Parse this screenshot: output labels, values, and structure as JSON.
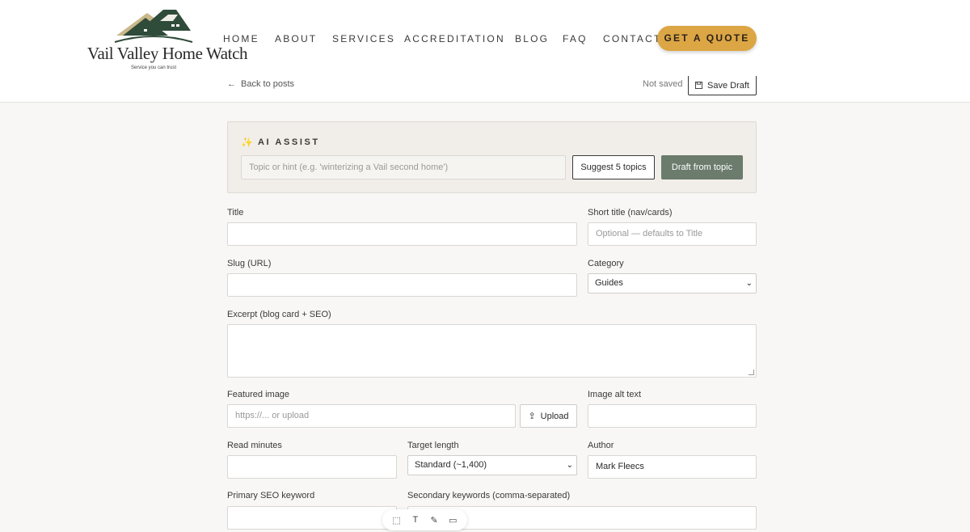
{
  "logo": {
    "name": "Vail Valley Home Watch",
    "tagline": "Service you can trust"
  },
  "nav": {
    "items": [
      "HOME",
      "ABOUT",
      "SERVICES",
      "ACCREDITATION",
      "BLOG",
      "FAQ",
      "CONTACT"
    ],
    "cta": "GET A QUOTE"
  },
  "editor_bar": {
    "back": "Back to posts",
    "status": "Not saved",
    "save": "Save Draft"
  },
  "ai_assist": {
    "title": "AI ASSIST",
    "topic_placeholder": "Topic or hint (e.g. 'winterizing a Vail second home')",
    "suggest": "Suggest 5 topics",
    "draft": "Draft from topic"
  },
  "form": {
    "title_label": "Title",
    "short_title_label": "Short title (nav/cards)",
    "short_title_placeholder": "Optional — defaults to Title",
    "slug_label": "Slug (URL)",
    "category_label": "Category",
    "category_value": "Guides",
    "excerpt_label": "Excerpt (blog card + SEO)",
    "featured_image_label": "Featured image",
    "featured_image_placeholder": "https://... or upload",
    "upload": "Upload",
    "alt_label": "Image alt text",
    "read_minutes_label": "Read minutes",
    "target_length_label": "Target length",
    "target_length_value": "Standard (~1,400)",
    "author_label": "Author",
    "author_value": "Mark Fleecs",
    "primary_kw_label": "Primary SEO keyword",
    "secondary_kw_label": "Secondary keywords (comma-separated)"
  },
  "colors": {
    "accent": "#dca645",
    "draft_button": "#6b7b6c",
    "logo_green": "#2f4b3a"
  }
}
